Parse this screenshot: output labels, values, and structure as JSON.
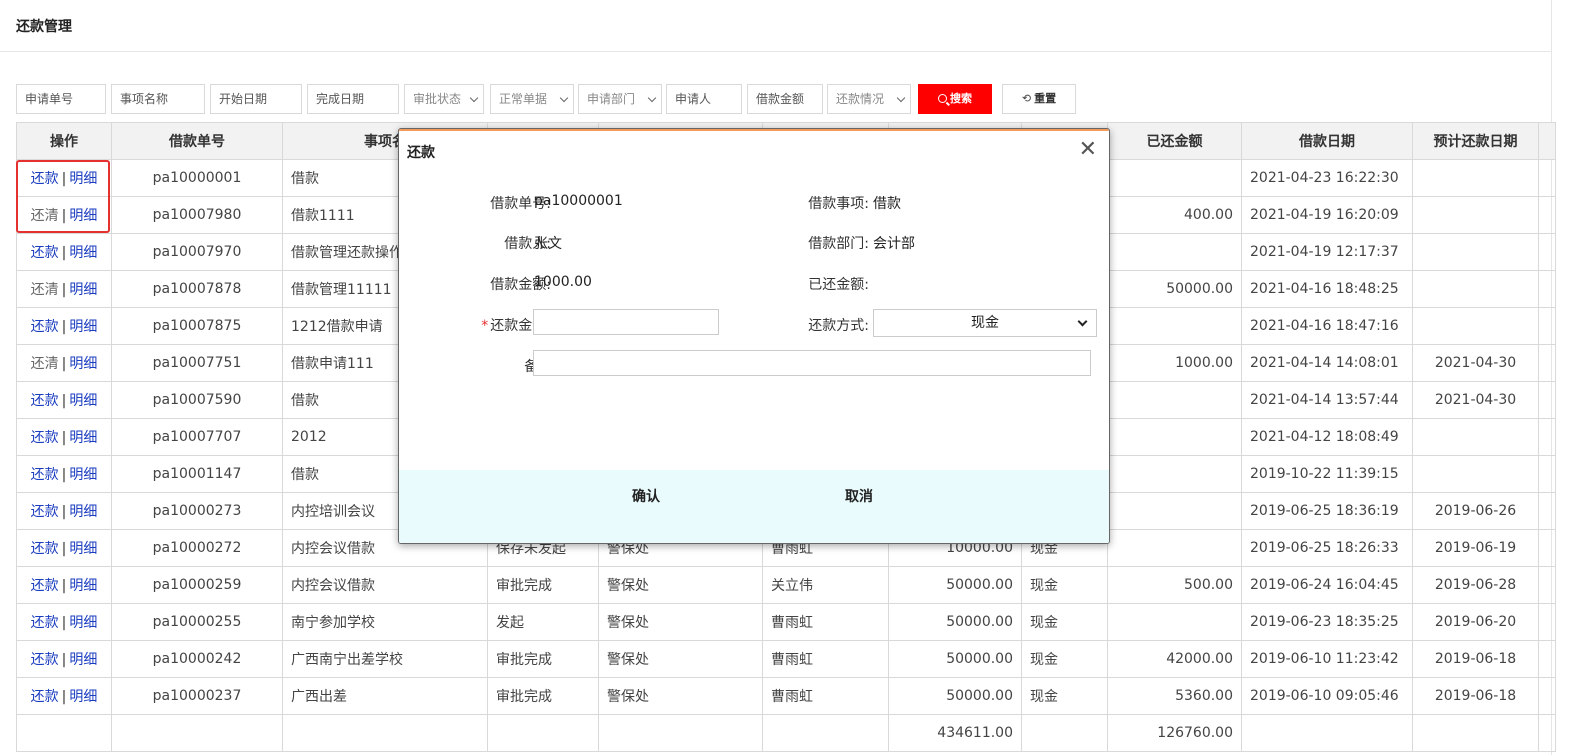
{
  "page": {
    "title": "还款管理"
  },
  "filters": {
    "apply_no": "申请单号",
    "item_name": "事项名称",
    "start_date": "开始日期",
    "end_date": "完成日期",
    "approval_status": "审批状态",
    "doc_type": "正常单据",
    "dept": "申请部门",
    "applicant": "申请人",
    "amount": "借款金额",
    "repay_status": "还款情况",
    "search": "搜索",
    "reset": "重置"
  },
  "table": {
    "headers": [
      "操作",
      "借款单号",
      "事项名",
      "",
      "",
      "",
      "",
      "",
      "已还金额",
      "借款日期",
      "预计还款日期"
    ],
    "rows": [
      {
        "op": "还款",
        "detail": "明细",
        "no": "pa10000001",
        "item": "借款",
        "status": "",
        "dept": "",
        "person": "",
        "amount": "",
        "method": "",
        "repaid": "",
        "date": "2021-04-23 16:22:30",
        "due": ""
      },
      {
        "op": "还清",
        "detail": "明细",
        "no": "pa10007980",
        "item": "借款1111",
        "status": "",
        "dept": "",
        "person": "",
        "amount": "",
        "method": "",
        "repaid": "400.00",
        "date": "2021-04-19 16:20:09",
        "due": ""
      },
      {
        "op": "还款",
        "detail": "明细",
        "no": "pa10007970",
        "item": "借款管理还款操作",
        "status": "",
        "dept": "",
        "person": "",
        "amount": "",
        "method": "",
        "repaid": "",
        "date": "2021-04-19 12:17:37",
        "due": ""
      },
      {
        "op": "还清",
        "detail": "明细",
        "no": "pa10007878",
        "item": "借款管理11111",
        "status": "",
        "dept": "",
        "person": "",
        "amount": "",
        "method": "",
        "repaid": "50000.00",
        "date": "2021-04-16 18:48:25",
        "due": ""
      },
      {
        "op": "还款",
        "detail": "明细",
        "no": "pa10007875",
        "item": "1212借款申请",
        "status": "",
        "dept": "",
        "person": "",
        "amount": "",
        "method": "",
        "repaid": "",
        "date": "2021-04-16 18:47:16",
        "due": ""
      },
      {
        "op": "还清",
        "detail": "明细",
        "no": "pa10007751",
        "item": "借款申请111",
        "status": "",
        "dept": "",
        "person": "",
        "amount": "",
        "method": "",
        "repaid": "1000.00",
        "date": "2021-04-14 14:08:01",
        "due": "2021-04-30"
      },
      {
        "op": "还款",
        "detail": "明细",
        "no": "pa10007590",
        "item": "借款",
        "status": "",
        "dept": "",
        "person": "",
        "amount": "",
        "method": "",
        "repaid": "",
        "date": "2021-04-14 13:57:44",
        "due": "2021-04-30"
      },
      {
        "op": "还款",
        "detail": "明细",
        "no": "pa10007707",
        "item": "2012",
        "status": "",
        "dept": "",
        "person": "",
        "amount": "",
        "method": "",
        "repaid": "",
        "date": "2021-04-12 18:08:49",
        "due": ""
      },
      {
        "op": "还款",
        "detail": "明细",
        "no": "pa10001147",
        "item": "借款",
        "status": "",
        "dept": "",
        "person": "",
        "amount": "",
        "method": "",
        "repaid": "",
        "date": "2019-10-22 11:39:15",
        "due": ""
      },
      {
        "op": "还款",
        "detail": "明细",
        "no": "pa10000273",
        "item": "内控培训会议",
        "status": "",
        "dept": "",
        "person": "",
        "amount": "",
        "method": "",
        "repaid": "",
        "date": "2019-06-25 18:36:19",
        "due": "2019-06-26"
      },
      {
        "op": "还款",
        "detail": "明细",
        "no": "pa10000272",
        "item": "内控会议借款",
        "status": "保存未发起",
        "dept": "警保处",
        "person": "曹雨虹",
        "amount": "10000.00",
        "method": "现金",
        "repaid": "",
        "date": "2019-06-25 18:26:33",
        "due": "2019-06-19"
      },
      {
        "op": "还款",
        "detail": "明细",
        "no": "pa10000259",
        "item": "内控会议借款",
        "status": "审批完成",
        "dept": "警保处",
        "person": "关立伟",
        "amount": "50000.00",
        "method": "现金",
        "repaid": "500.00",
        "date": "2019-06-24 16:04:45",
        "due": "2019-06-28"
      },
      {
        "op": "还款",
        "detail": "明细",
        "no": "pa10000255",
        "item": "南宁参加学校",
        "status": "发起",
        "dept": "警保处",
        "person": "曹雨虹",
        "amount": "50000.00",
        "method": "现金",
        "repaid": "",
        "date": "2019-06-23 18:35:25",
        "due": "2019-06-20"
      },
      {
        "op": "还款",
        "detail": "明细",
        "no": "pa10000242",
        "item": "广西南宁出差学校",
        "status": "审批完成",
        "dept": "警保处",
        "person": "曹雨虹",
        "amount": "50000.00",
        "method": "现金",
        "repaid": "42000.00",
        "date": "2019-06-10 11:23:42",
        "due": "2019-06-18"
      },
      {
        "op": "还款",
        "detail": "明细",
        "no": "pa10000237",
        "item": "广西出差",
        "status": "审批完成",
        "dept": "警保处",
        "person": "曹雨虹",
        "amount": "50000.00",
        "method": "现金",
        "repaid": "5360.00",
        "date": "2019-06-10 09:05:46",
        "due": "2019-06-18"
      }
    ],
    "total_amount": "434611.00",
    "total_repaid": "126760.00"
  },
  "modal": {
    "title": "还款",
    "close": "✕",
    "loan_no_label": "借款单号:",
    "loan_no": "pa10000001",
    "loan_item_label": "借款事项:",
    "loan_item": "借款",
    "borrower_label": "借款人:",
    "borrower": "张文",
    "dept_label": "借款部门:",
    "dept": "会计部",
    "amount_label": "借款金额:",
    "amount": "1000.00",
    "repaid_label": "已还金额:",
    "repaid": "",
    "repay_amount_label": "还款金额:",
    "repay_amount": "",
    "method_label": "还款方式:",
    "method": "现金",
    "note_label": "备注:",
    "note": "",
    "confirm": "确认",
    "cancel": "取消"
  }
}
